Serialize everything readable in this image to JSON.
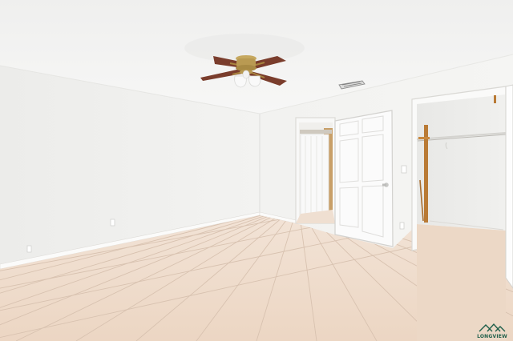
{
  "watermark": {
    "text": "LONGVIEW"
  },
  "colors": {
    "wall": "#f1f0ee",
    "ceiling": "#f4f4f3",
    "floor_tile": "#eedbcb",
    "grout": "#d6bfae",
    "door": "#fafafa",
    "fan_blade": "#7a3d2c",
    "fan_brass": "#b99a52",
    "closet_rod_wood": "#b97a35",
    "curtain": "#f7f7f7"
  }
}
